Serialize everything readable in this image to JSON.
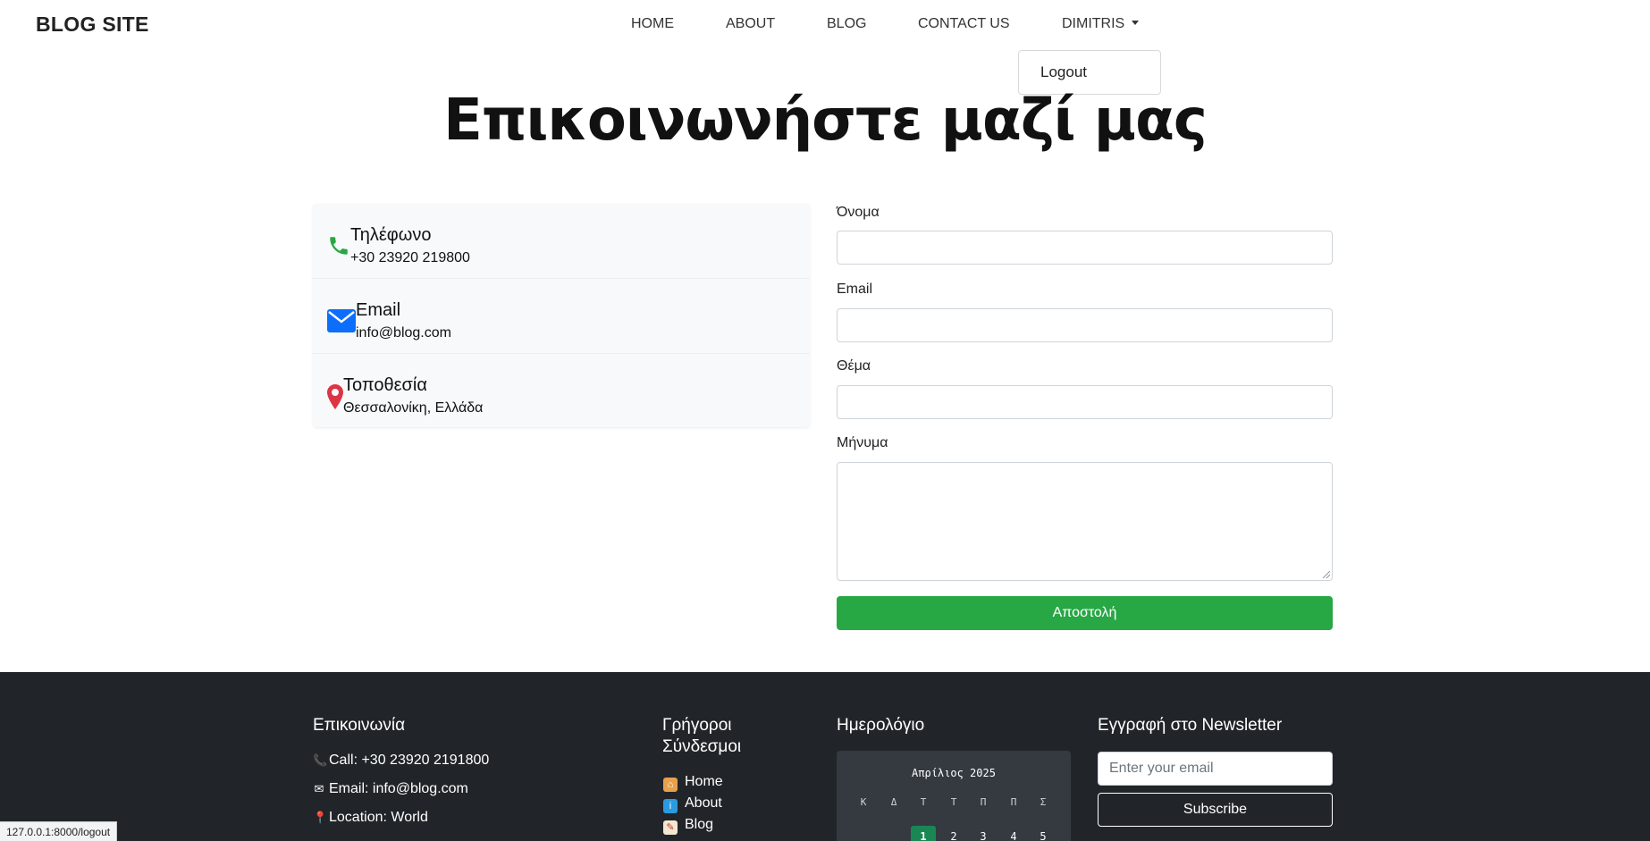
{
  "navbar": {
    "brand": "BLOG SITE",
    "links": [
      "HOME",
      "ABOUT",
      "BLOG",
      "CONTACT US"
    ],
    "user_menu": "DIMITRIS",
    "dropdown": {
      "logout": "Logout"
    }
  },
  "page": {
    "title": "Επικοινωνήστε μαζί μας"
  },
  "contact_info": {
    "phone": {
      "title": "Τηλέφωνο",
      "value": "+30 23920 219800",
      "icon": "phone-icon",
      "color": "#28a745"
    },
    "email": {
      "title": "Email",
      "value": "info@blog.com",
      "icon": "envelope-icon",
      "color": "#0d6efd"
    },
    "location": {
      "title": "Τοποθεσία",
      "value": "Θεσσαλονίκη, Ελλάδα",
      "icon": "map-marker-icon",
      "color": "#dc3545"
    }
  },
  "form": {
    "name_label": "Όνομα",
    "email_label": "Email",
    "subject_label": "Θέμα",
    "message_label": "Μήνυμα",
    "name_value": "",
    "email_value": "",
    "subject_value": "",
    "message_value": "",
    "submit": "Αποστολή",
    "submit_color": "#28a745"
  },
  "footer": {
    "contact": {
      "heading": "Επικοινωνία",
      "call": "Call: +30 23920 2191800",
      "email": "Email: info@blog.com",
      "location": "Location: World"
    },
    "quick_links": {
      "heading_line1": "Γρήγοροι",
      "heading_line2": "Σύνδεσμοι",
      "items": [
        {
          "label": "Home",
          "icon": "house-icon"
        },
        {
          "label": "About",
          "icon": "info-icon"
        },
        {
          "label": "Blog",
          "icon": "memo-icon"
        }
      ]
    },
    "calendar": {
      "heading": "Ημερολόγιο",
      "month": "Απρίλιος 2025",
      "weekdays": [
        "Κ",
        "Δ",
        "Τ",
        "Τ",
        "Π",
        "Π",
        "Σ"
      ],
      "days": [
        "",
        "",
        "1",
        "2",
        "3",
        "4",
        "5"
      ],
      "today": "1"
    },
    "newsletter": {
      "heading": "Εγγραφή στο Newsletter",
      "placeholder": "Enter your email",
      "button": "Subscribe"
    }
  },
  "status_bar": {
    "url": "127.0.0.1:8000/logout"
  }
}
